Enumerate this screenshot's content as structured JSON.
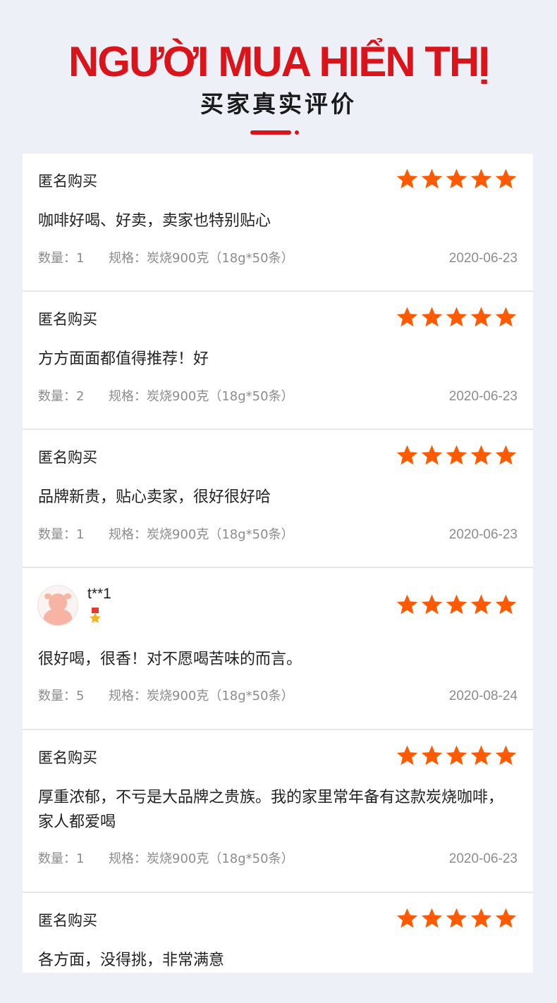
{
  "header": {
    "title": "NGƯỜI MUA HIỂN THỊ",
    "subtitle": "买家真实评价"
  },
  "colors": {
    "accent": "#d9141b",
    "star": "#ff5a00",
    "meta": "#8c8c8c"
  },
  "star_icon": "star-icon",
  "reviews": [
    {
      "user": "匿名购买",
      "rating": 5,
      "text": "咖啡好喝、好卖，卖家也特别贴心",
      "qty": "数量：1",
      "spec": "规格：炭烧900克（18g*50条）",
      "date": "2020-06-23"
    },
    {
      "user": "匿名购买",
      "rating": 5,
      "text": "方方面面都值得推荐！好",
      "qty": "数量：2",
      "spec": "规格：炭烧900克（18g*50条）",
      "date": "2020-06-23"
    },
    {
      "user": "匿名购买",
      "rating": 5,
      "text": "品牌新贵，贴心卖家，很好很好哈",
      "qty": "数量：1",
      "spec": "规格：炭烧900克（18g*50条）",
      "date": "2020-06-23"
    },
    {
      "user": "t**1",
      "rating": 5,
      "text": "很好喝，很香！对不愿喝苦味的而言。",
      "qty": "数量：5",
      "spec": "规格：炭烧900克（18g*50条）",
      "date": "2020-08-24"
    },
    {
      "user": "匿名购买",
      "rating": 5,
      "text": "厚重浓郁，不亏是大品牌之贵族。我的家里常年备有这款炭烧咖啡，家人都爱喝",
      "qty": "数量：1",
      "spec": "规格：炭烧900克（18g*50条）",
      "date": "2020-06-23"
    },
    {
      "user": "匿名购买",
      "rating": 5,
      "text": "各方面，没得挑，非常满意"
    }
  ]
}
